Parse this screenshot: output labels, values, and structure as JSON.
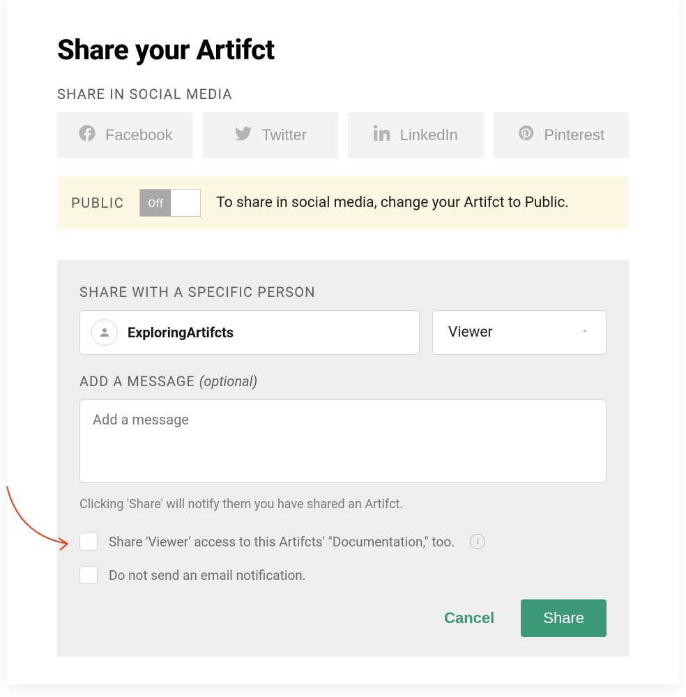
{
  "title": "Share your Artifct",
  "social": {
    "label": "SHARE IN SOCIAL MEDIA",
    "buttons": {
      "facebook": "Facebook",
      "twitter": "Twitter",
      "linkedin": "LinkedIn",
      "pinterest": "Pinterest"
    }
  },
  "public_bar": {
    "label": "PUBLIC",
    "toggle_state": "Off",
    "hint": "To share in social media, change your Artifct to Public."
  },
  "share_person": {
    "label": "SHARE WITH A SPECIFIC PERSON",
    "person_name": "ExploringArtifcts",
    "role_selected": "Viewer"
  },
  "message": {
    "label": "ADD A MESSAGE ",
    "optional": "(optional)",
    "placeholder": "Add a message",
    "value": ""
  },
  "notify_hint": "Clicking 'Share' will notify them you have shared an Artifct.",
  "checkbox_doc": "Share 'Viewer' access to this Artifcts' \"Documentation,\" too.",
  "checkbox_email": "Do not send an email notification.",
  "actions": {
    "cancel": "Cancel",
    "share": "Share"
  }
}
